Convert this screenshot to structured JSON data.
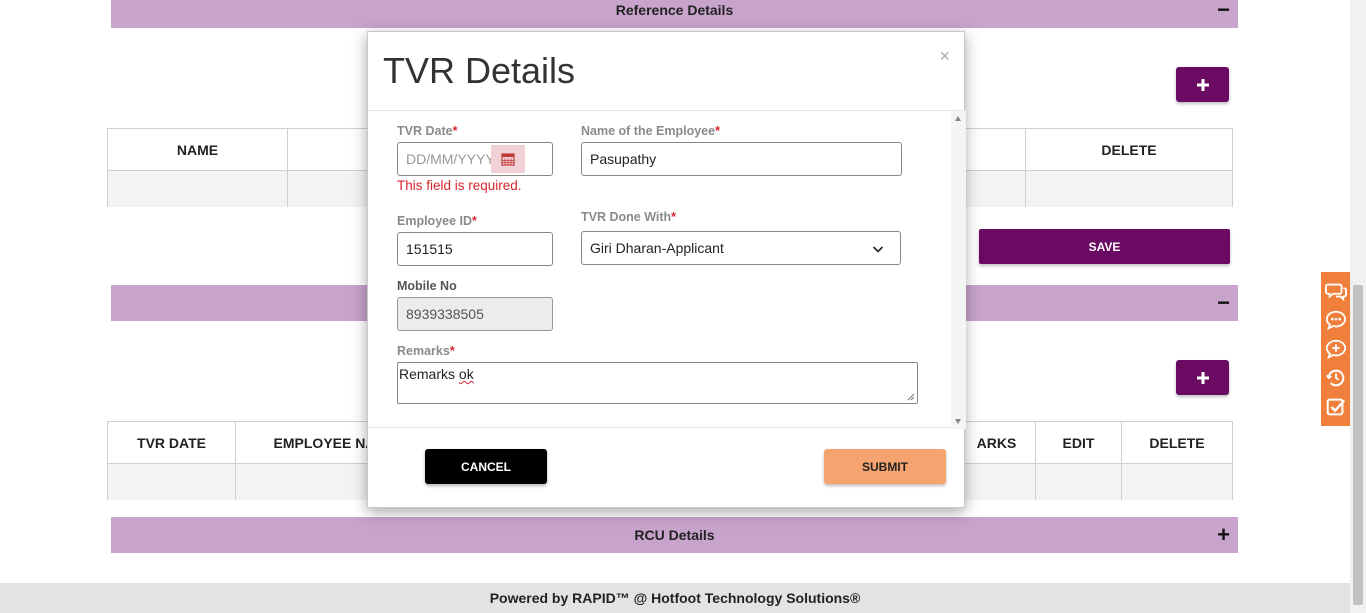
{
  "sections": {
    "reference": {
      "title": "Reference Details",
      "toggle": "−"
    },
    "tvr": {
      "toggle": "−"
    },
    "rcu": {
      "title": "RCU Details",
      "toggle": "+"
    }
  },
  "reference_table": {
    "headers": [
      "NAME",
      "",
      "DELETE"
    ]
  },
  "save_button": "SAVE",
  "tvr_table": {
    "headers": [
      "TVR DATE",
      "EMPLOYEE NA",
      "",
      "ARKS",
      "EDIT",
      "DELETE"
    ]
  },
  "footer": {
    "text": "Powered by RAPID™ @ Hotfoot Technology Solutions®"
  },
  "modal": {
    "title": "TVR Details",
    "close": "×",
    "tvr_date": {
      "label": "TVR Date",
      "required": "*",
      "placeholder": "DD/MM/YYYY",
      "error": "This field is required."
    },
    "employee_name": {
      "label": "Name of the Employee",
      "required": "*",
      "value": "Pasupathy"
    },
    "employee_id": {
      "label": "Employee ID",
      "required": "*",
      "value": "151515"
    },
    "tvr_done_with": {
      "label": "TVR Done With",
      "required": "*",
      "value": "Giri Dharan-Applicant"
    },
    "mobile_no": {
      "label": "Mobile No",
      "value": "8939338505"
    },
    "remarks": {
      "label": "Remarks",
      "required": "*",
      "value_word1": "Remarks",
      "value_word2": "ok"
    },
    "cancel_label": "CANCEL",
    "submit_label": "SUBMIT"
  },
  "colors": {
    "section_header": "#c8a3cc",
    "primary_button": "#6a0a62",
    "submit_button": "#f5a36f",
    "side_widget": "#f07f3c",
    "error": "#d8262c"
  },
  "icons": {
    "add": "plus-icon",
    "calendar": "calendar-icon",
    "select": "chevron-down-icon",
    "side_widget": [
      "chat-icon",
      "comment-icon",
      "add-comment-icon",
      "history-icon",
      "checklist-icon"
    ]
  }
}
